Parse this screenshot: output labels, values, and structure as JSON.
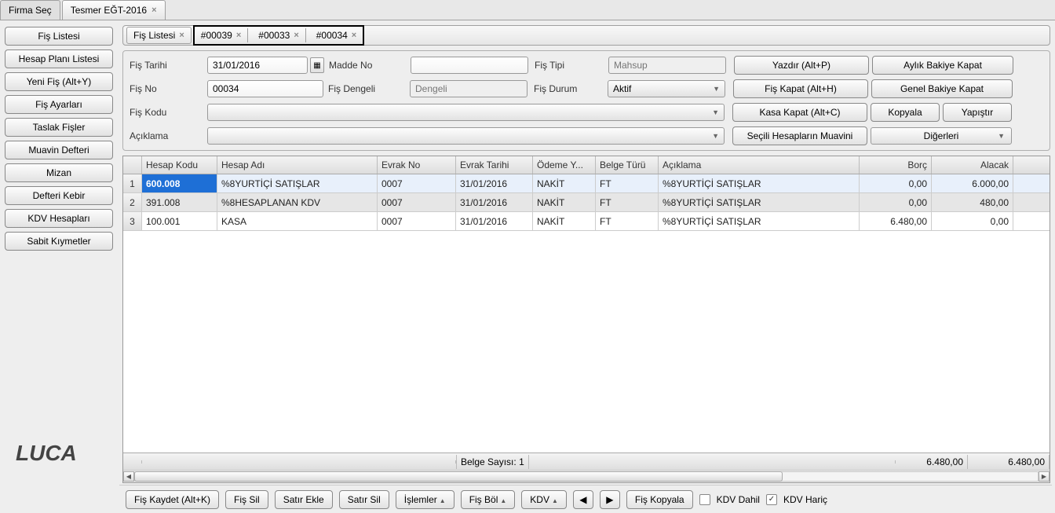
{
  "top_tabs": {
    "firma": "Firma Seç",
    "tesmer": "Tesmer EĞT-2016"
  },
  "sidebar": {
    "fis_listesi": "Fiş Listesi",
    "hesap_plani": "Hesap Planı Listesi",
    "yeni_fis": "Yeni Fiş (Alt+Y)",
    "fis_ayarlari": "Fiş Ayarları",
    "taslak": "Taslak Fişler",
    "muavin": "Muavin Defteri",
    "mizan": "Mizan",
    "defteri_kebir": "Defteri Kebir",
    "kdv": "KDV Hesapları",
    "sabit": "Sabit Kıymetler"
  },
  "logo": "LUCA",
  "inner_tabs": {
    "list": "Fiş Listesi",
    "t1": "#00039",
    "t2": "#00033",
    "t3": "#00034"
  },
  "form": {
    "lbl_tarih": "Fiş Tarihi",
    "tarih": "31/01/2016",
    "lbl_madde": "Madde No",
    "lbl_tip": "Fiş Tipi",
    "tip_ph": "Mahsup",
    "lbl_no": "Fiş No",
    "no": "00034",
    "lbl_dengeli": "Fiş Dengeli",
    "dengeli_ph": "Dengeli",
    "lbl_durum": "Fiş Durum",
    "durum": "Aktif",
    "lbl_kodu": "Fiş Kodu",
    "lbl_aciklama": "Açıklama"
  },
  "right_buttons": {
    "yazdir": "Yazdır (Alt+P)",
    "aylik": "Aylık Bakiye Kapat",
    "fis_kapat": "Fiş Kapat (Alt+H)",
    "genel": "Genel Bakiye Kapat",
    "kasa": "Kasa Kapat (Alt+C)",
    "kopyala": "Kopyala",
    "yapistir": "Yapıştır",
    "secili": "Seçili Hesapların Muavini",
    "digerleri": "Diğerleri"
  },
  "grid": {
    "headers": {
      "hk": "Hesap Kodu",
      "ha": "Hesap Adı",
      "en": "Evrak No",
      "et": "Evrak Tarihi",
      "oy": "Ödeme Y...",
      "bt": "Belge Türü",
      "ac": "Açıklama",
      "br": "Borç",
      "al": "Alacak"
    },
    "rows": [
      {
        "n": "1",
        "hk": "600.008",
        "ha": "%8YURTİÇİ SATIŞLAR",
        "en": "0007",
        "et": "31/01/2016",
        "oy": "NAKİT",
        "bt": "FT",
        "ac": "%8YURTİÇİ SATIŞLAR",
        "br": "0,00",
        "al": "6.000,00"
      },
      {
        "n": "2",
        "hk": "391.008",
        "ha": "%8HESAPLANAN KDV",
        "en": "0007",
        "et": "31/01/2016",
        "oy": "NAKİT",
        "bt": "FT",
        "ac": "%8YURTİÇİ SATIŞLAR",
        "br": "0,00",
        "al": "480,00"
      },
      {
        "n": "3",
        "hk": "100.001",
        "ha": "KASA",
        "en": "0007",
        "et": "31/01/2016",
        "oy": "NAKİT",
        "bt": "FT",
        "ac": "%8YURTİÇİ SATIŞLAR",
        "br": "6.480,00",
        "al": "0,00"
      }
    ],
    "footer": {
      "belge_label": "Belge Sayısı:",
      "belge": "1",
      "borc": "6.480,00",
      "alacak": "6.480,00"
    }
  },
  "bottom": {
    "kaydet": "Fiş Kaydet (Alt+K)",
    "sil": "Fiş Sil",
    "satir_ekle": "Satır Ekle",
    "satir_sil": "Satır Sil",
    "islemler": "İşlemler",
    "bol": "Fiş Böl",
    "kdv": "KDV",
    "kopyala": "Fiş Kopyala",
    "kdv_dahil": "KDV Dahil",
    "kdv_haric": "KDV Hariç"
  }
}
